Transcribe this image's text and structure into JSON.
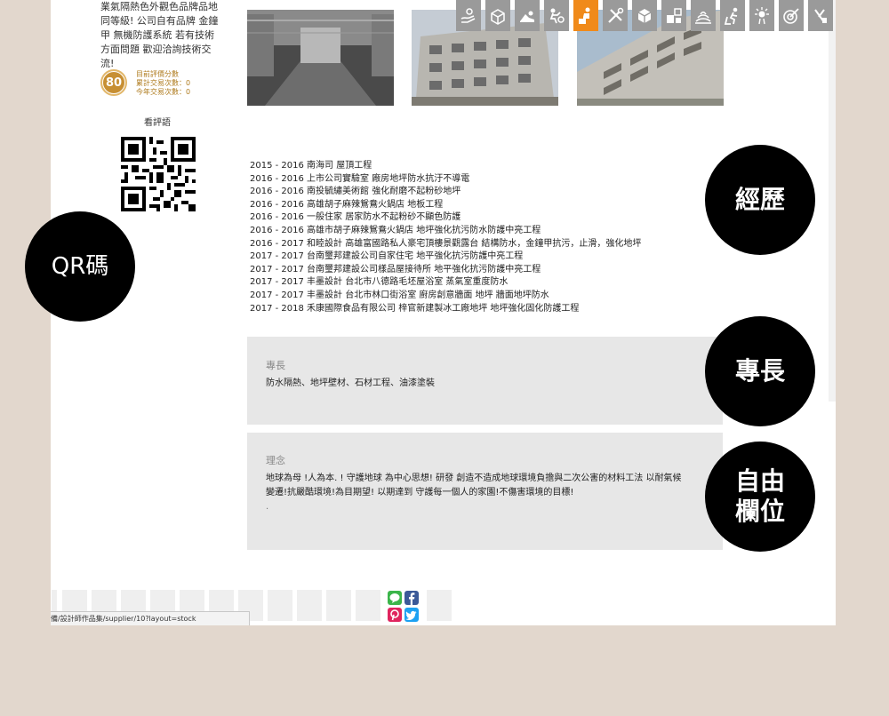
{
  "profile": {
    "intro_lines": [
      "業氣隔熱色外觀色品牌品地",
      "同等級! 公司自有品牌 金鐘",
      "甲 無機防護系統 若有技術",
      "方面問題 歡迎洽詢技術交",
      "流!"
    ],
    "score": "80",
    "score_label": "目前評價分數",
    "total_trades": "累計交易次數：0",
    "year_trades": "今年交易次數：0",
    "reviews_link": "看評語"
  },
  "photos": [
    {
      "name": "warehouse-photo"
    },
    {
      "name": "building-photo-1"
    },
    {
      "name": "building-photo-2"
    }
  ],
  "experience": [
    "2015 - 2016 南海司 屋頂工程",
    "2016 - 2016 上市公司實驗室 廠房地坪防水抗汙不導電",
    "2016 - 2016 南投毓繡美術館 強化耐磨不起粉砂地坪",
    "2016 - 2016 高雄胡子麻辣鴛鴦火鍋店 地板工程",
    "2016 - 2016 一般住家 居家防水不起粉砂不顯色防護",
    "2016 - 2016 高雄市胡子麻辣鴛鴦火鍋店 地坪強化抗污防水防護中亮工程",
    "2016 - 2017 和睦設計 高雄富國路私人豪宅頂樓景觀露台 結構防水，金鐘甲抗污，止滑，強化地坪",
    "2017 - 2017 台南璽邦建設公司自家住宅 地平強化抗污防護中亮工程",
    "2017 - 2017 台南璽邦建設公司樣品屋接待所 地平強化抗污防護中亮工程",
    "2017 - 2017 丰墨設計 台北市八德路毛坯屋浴室 蒸氣室重度防水",
    "2017 - 2017 丰墨設計 台北市林口街浴室 廚房創意牆面 地坪 牆面地坪防水",
    "2017 - 2018 禾康國際食品有限公司 梓官新建製冰工廠地坪 地坪強化固化防護工程"
  ],
  "specialty": {
    "title": "專長",
    "text": "防水隔熱、地坪壁材、石材工程、油漆塗裝"
  },
  "philosophy": {
    "title": "理念",
    "line1": "地球為母 !人為本. ! 守護地球 為中心思想! 研發 創造不造成地球環境負擔與二次公害的材料工法 以耐氣候",
    "line2": "變遷!抗嚴酷環境!為目期望! 以期達到 守護每一個人的家園!不傷害環境的目標!",
    "line3": "."
  },
  "callouts": {
    "qr": "QR碼",
    "experience": "經歷",
    "specialty": "專長",
    "free_field_1": "自由",
    "free_field_2": "欄位"
  },
  "status_bar": {
    "url": "備/設計師作品集/supplier/10?layout=stock"
  },
  "colors": {
    "accent_orange": "#f08a1a",
    "badge_gold": "#c9953a",
    "line_green": "#3bb54a",
    "facebook_blue": "#3b5998",
    "pinterest_red": "#e0245e",
    "twitter_blue": "#1da1f2"
  },
  "icons": [
    "hand-care-icon",
    "box-delivery-icon",
    "lying-person-icon",
    "moving-icon",
    "worker-icon",
    "tools-icon",
    "package-icon",
    "design-icon",
    "floor-icon",
    "cleaning-icon",
    "light-icon",
    "target-icon",
    "renovate-icon"
  ]
}
